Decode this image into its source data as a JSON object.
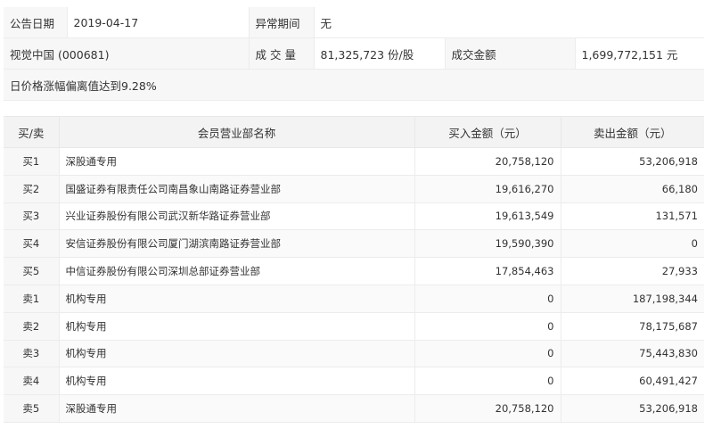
{
  "info": {
    "row1": {
      "announce_date_label": "公告日期",
      "announce_date_value": "2019-04-17",
      "abnormal_period_label": "异常期间",
      "abnormal_period_value": "无"
    },
    "row2": {
      "stock_name": "视觉中国 (000681)",
      "volume_label": "成 交 量",
      "volume_value": "81,325,723 份/股",
      "turnover_label": "成交金额",
      "turnover_value": "1,699,772,151 元"
    },
    "reason": "日价格涨幅偏离值达到9.28%"
  },
  "table": {
    "headers": [
      "买/卖",
      "会员营业部名称",
      "买入金额（元）",
      "卖出金额（元）"
    ],
    "rows": [
      {
        "side": "买1",
        "name": "深股通专用",
        "buy": "20,758,120",
        "sell": "53,206,918"
      },
      {
        "side": "买2",
        "name": "国盛证券有限责任公司南昌象山南路证券营业部",
        "buy": "19,616,270",
        "sell": "66,180"
      },
      {
        "side": "买3",
        "name": "兴业证券股份有限公司武汉新华路证券营业部",
        "buy": "19,613,549",
        "sell": "131,571"
      },
      {
        "side": "买4",
        "name": "安信证券股份有限公司厦门湖滨南路证券营业部",
        "buy": "19,590,390",
        "sell": "0"
      },
      {
        "side": "买5",
        "name": "中信证券股份有限公司深圳总部证券营业部",
        "buy": "17,854,463",
        "sell": "27,933"
      },
      {
        "side": "卖1",
        "name": "机构专用",
        "buy": "0",
        "sell": "187,198,344"
      },
      {
        "side": "卖2",
        "name": "机构专用",
        "buy": "0",
        "sell": "78,175,687"
      },
      {
        "side": "卖3",
        "name": "机构专用",
        "buy": "0",
        "sell": "75,443,830"
      },
      {
        "side": "卖4",
        "name": "机构专用",
        "buy": "0",
        "sell": "60,491,427"
      },
      {
        "side": "卖5",
        "name": "深股通专用",
        "buy": "20,758,120",
        "sell": "53,206,918"
      }
    ]
  }
}
